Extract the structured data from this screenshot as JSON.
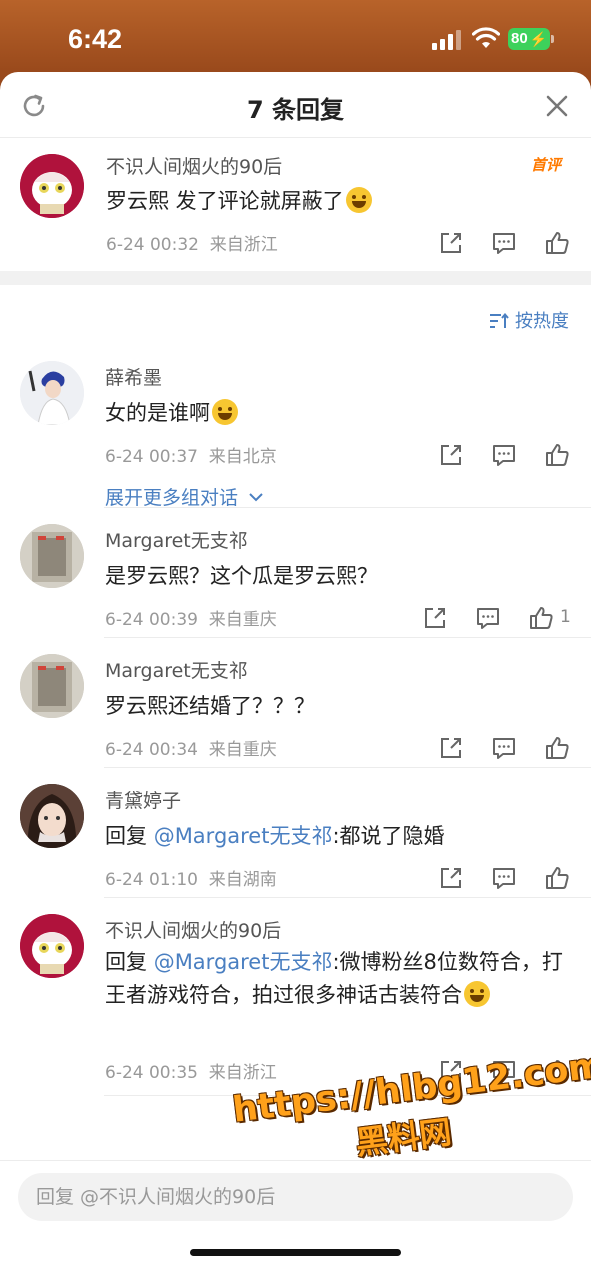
{
  "status_bar": {
    "time": "6:42",
    "battery": "80"
  },
  "header": {
    "title": "7 条回复"
  },
  "root": {
    "author": "不识人间烟火的90后",
    "badge": "首评",
    "text": "罗云熙 发了评论就屏蔽了",
    "date": "6-24 00:32",
    "location": "来自浙江"
  },
  "sort": {
    "label": "按热度"
  },
  "replies": [
    {
      "author": "薛希墨",
      "text": "女的是谁啊",
      "date": "6-24 00:37",
      "location": "来自北京",
      "likes": "",
      "expand": "展开更多组对话"
    },
    {
      "author": "Margaret无支祁",
      "text": "是罗云熙？这个瓜是罗云熙？",
      "date": "6-24 00:39",
      "location": "来自重庆",
      "likes": "1"
    },
    {
      "author": "Margaret无支祁",
      "text": "罗云熙还结婚了？？？",
      "date": "6-24 00:34",
      "location": "来自重庆",
      "likes": ""
    },
    {
      "author": "青黛婷子",
      "reply_prefix": "回复 ",
      "mention": "@Margaret无支祁",
      "text": ":都说了隐婚",
      "date": "6-24 01:10",
      "location": "来自湖南",
      "likes": ""
    },
    {
      "author": "不识人间烟火的90后",
      "reply_prefix": "回复 ",
      "mention": "@Margaret无支祁",
      "text": ":微博粉丝8位数符合，打王者游戏符合，拍过很多神话古装符合",
      "date": "6-24 00:35",
      "location": "来自浙江",
      "likes": ""
    }
  ],
  "reply_box": {
    "placeholder": "回复 @不识人间烟火的90后"
  },
  "watermark": {
    "url": "https://hlbg12.com",
    "name": "黑料网"
  },
  "colors": {
    "link": "#4a7fc1",
    "badge": "#ff7a00",
    "battery": "#3dd15b"
  },
  "icons": {
    "share": "share-icon",
    "comment": "comment-icon",
    "like": "like-icon",
    "refresh": "refresh-icon",
    "close": "close-icon"
  }
}
